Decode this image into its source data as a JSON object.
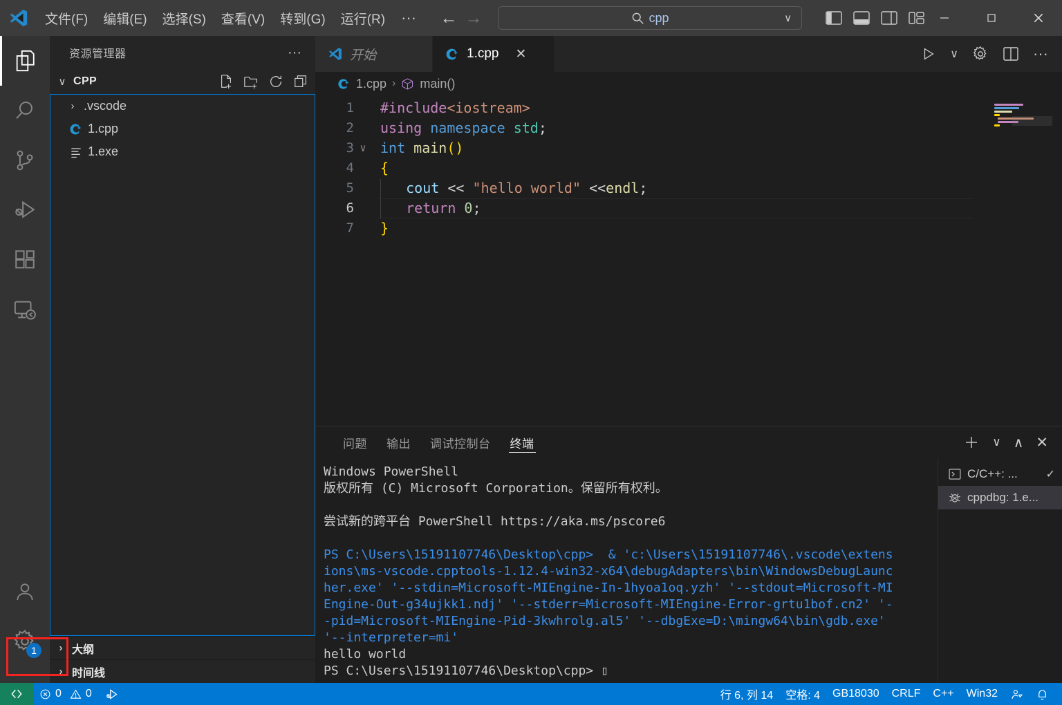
{
  "titlebar": {
    "menus": [
      {
        "label": "文件(F)",
        "name": "menu-file"
      },
      {
        "label": "编辑(E)",
        "name": "menu-edit"
      },
      {
        "label": "选择(S)",
        "name": "menu-selection"
      },
      {
        "label": "查看(V)",
        "name": "menu-view"
      },
      {
        "label": "转到(G)",
        "name": "menu-go"
      },
      {
        "label": "运行(R)",
        "name": "menu-run"
      }
    ],
    "more_label": "···",
    "quick_open_value": "cpp",
    "quick_open_placeholder": "cpp",
    "back_arrow": "←",
    "forward_arrow": "→",
    "minimize": "─",
    "maximize": "☐",
    "close": "✕"
  },
  "activitybar": {
    "items": [
      {
        "name": "activity-explorer",
        "label": "资源管理器"
      },
      {
        "name": "activity-search",
        "label": "搜索"
      },
      {
        "name": "activity-source-control",
        "label": "源代码管理"
      },
      {
        "name": "activity-run-debug",
        "label": "运行和调试"
      },
      {
        "name": "activity-extensions",
        "label": "扩展"
      },
      {
        "name": "activity-remote",
        "label": "远程资源管理器"
      }
    ],
    "settings_badge": "1",
    "settings_label": "管理"
  },
  "sidebar": {
    "title": "资源管理器",
    "more_label": "···",
    "folder": {
      "name": "CPP",
      "chevron": "∨"
    },
    "files": [
      {
        "label": ".vscode",
        "icon": "folder-chevron-icon",
        "type": "folder"
      },
      {
        "label": "1.cpp",
        "icon": "cpp-file-icon",
        "type": "file"
      },
      {
        "label": "1.exe",
        "icon": "binary-file-icon",
        "type": "file"
      }
    ],
    "sections": [
      {
        "label": "大纲"
      },
      {
        "label": "时间线"
      }
    ]
  },
  "tabs": [
    {
      "label": "开始",
      "icon": "vscode-logo-icon",
      "active": false,
      "italic": true,
      "closable": false
    },
    {
      "label": "1.cpp",
      "icon": "cpp-file-icon",
      "active": true,
      "italic": false,
      "closable": true,
      "close_label": "✕"
    }
  ],
  "editor_actions": {
    "run": "run-icon",
    "run_chevron": "∨",
    "settings": "gear-icon",
    "split": "split-editor-icon",
    "more": "···"
  },
  "breadcrumb": {
    "file": "1.cpp",
    "separator": "›",
    "symbol": "main()"
  },
  "code": {
    "lines": [
      {
        "num": "1",
        "fold": "",
        "active": false
      },
      {
        "num": "2",
        "fold": "",
        "active": false
      },
      {
        "num": "3",
        "fold": "∨",
        "active": false
      },
      {
        "num": "4",
        "fold": "",
        "active": false
      },
      {
        "num": "5",
        "fold": "",
        "active": false
      },
      {
        "num": "6",
        "fold": "",
        "active": true
      },
      {
        "num": "7",
        "fold": "",
        "active": false
      }
    ],
    "text": {
      "l1_pp": "#include",
      "l1_inc": "<iostream>",
      "l2_kw": "using",
      "l2_kw2": "namespace",
      "l2_ns": "std",
      "l2_semi": ";",
      "l3_type": "int",
      "l3_fn": "main",
      "l3_paren": "()",
      "l4_brace": "{",
      "l5_var": "cout",
      "l5_op1": "<<",
      "l5_str": "\"hello world\"",
      "l5_op2": "<<",
      "l5_endl": "endl",
      "l5_semi": ";",
      "l6_kw": "return",
      "l6_num": "0",
      "l6_semi": ";",
      "l7_brace": "}"
    }
  },
  "panel": {
    "tabs": [
      {
        "label": "问题",
        "active": false
      },
      {
        "label": "输出",
        "active": false
      },
      {
        "label": "调试控制台",
        "active": false
      },
      {
        "label": "终端",
        "active": true
      }
    ],
    "actions": {
      "new_terminal": "+",
      "new_chevron": "∨",
      "maximize": "∧",
      "close": "✕"
    },
    "terminal_lines": [
      {
        "text": "Windows PowerShell",
        "color": "white"
      },
      {
        "text": "版权所有 (C) Microsoft Corporation。保留所有权利。",
        "color": "white"
      },
      {
        "text": "",
        "color": "white"
      },
      {
        "text": "尝试新的跨平台 PowerShell https://aka.ms/pscore6",
        "color": "white"
      },
      {
        "text": "",
        "color": "white"
      },
      {
        "text": "PS C:\\Users\\15191107746\\Desktop\\cpp>  & 'c:\\Users\\15191107746\\.vscode\\extens",
        "color": "blue"
      },
      {
        "text": "ions\\ms-vscode.cpptools-1.12.4-win32-x64\\debugAdapters\\bin\\WindowsDebugLaunc",
        "color": "blue"
      },
      {
        "text": "her.exe' '--stdin=Microsoft-MIEngine-In-1hyoa1oq.yzh' '--stdout=Microsoft-MI",
        "color": "blue"
      },
      {
        "text": "Engine-Out-g34ujkk1.ndj' '--stderr=Microsoft-MIEngine-Error-grtu1bof.cn2' '-",
        "color": "blue"
      },
      {
        "text": "-pid=Microsoft-MIEngine-Pid-3kwhrolg.al5' '--dbgExe=D:\\mingw64\\bin\\gdb.exe'",
        "color": "blue"
      },
      {
        "text": "'--interpreter=mi'",
        "color": "blue"
      },
      {
        "text": "hello world",
        "color": "white"
      },
      {
        "text": "PS C:\\Users\\15191107746\\Desktop\\cpp> ",
        "color": "white",
        "cursor": true
      }
    ],
    "terminal_instances": [
      {
        "label": "C/C++: ...",
        "icon": "terminal-icon",
        "selected": false,
        "check": "✓"
      },
      {
        "label": "cppdbg: 1.e...",
        "icon": "bug-icon",
        "selected": true,
        "check": ""
      }
    ]
  },
  "statusbar": {
    "remote_label": "remote-indicator-icon",
    "errors": "0",
    "warnings": "0",
    "line_col": "行 6, 列 14",
    "spaces": "空格: 4",
    "encoding": "GB18030",
    "eol": "CRLF",
    "language": "C++",
    "platform": "Win32",
    "feedback": "feedback-icon",
    "bell": "🔔"
  },
  "colors": {
    "accent": "#0078d4",
    "remote_green": "#16825d",
    "titlebar": "#3c3c3c",
    "sidebar": "#252526",
    "editor": "#1e1e1e",
    "activitybar": "#333333",
    "annotation_red": "#f4231f",
    "focus_border": "#0078d4"
  }
}
